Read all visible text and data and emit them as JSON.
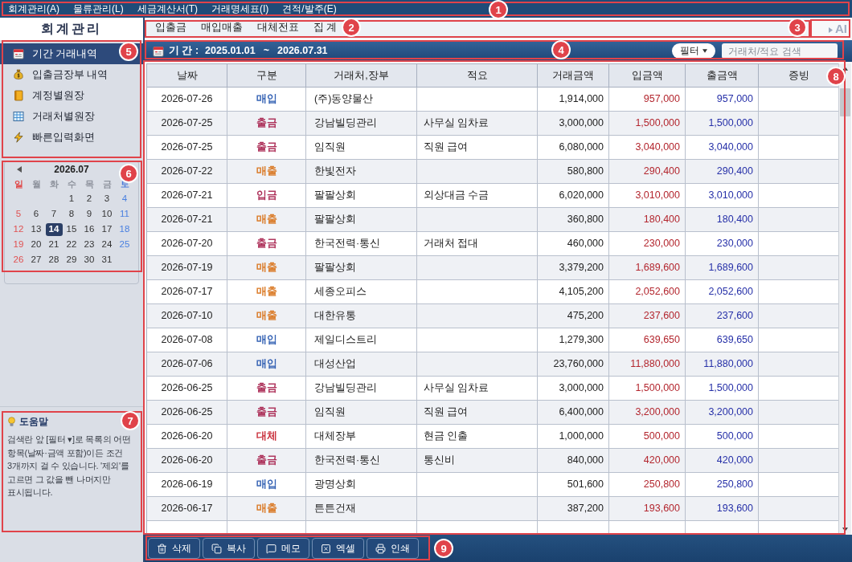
{
  "menu_bar": {
    "callout": "1",
    "items": [
      "회계관리(A)",
      "물류관리(L)",
      "세금계산서(T)",
      "거래명세표(I)",
      "견적/발주(E)"
    ]
  },
  "sidebar": {
    "title": "회계관리",
    "nav": {
      "callout": "5",
      "items": [
        {
          "label": "기간 거래내역",
          "selected": true
        },
        {
          "label": "입출금장부 내역",
          "selected": false
        },
        {
          "label": "계정별원장",
          "selected": false
        },
        {
          "label": "거래처별원장",
          "selected": false
        },
        {
          "label": "빠른입력화면",
          "selected": false
        }
      ]
    },
    "calendar": {
      "callout": "6",
      "month": "2026.07",
      "weekdays": [
        "일",
        "월",
        "화",
        "수",
        "목",
        "금",
        "토"
      ],
      "weeks": [
        {
          "days": [
            {
              "day": "1",
              "selected": false
            },
            {
              "day": "2",
              "selected": false
            },
            {
              "day": "3",
              "selected": false
            },
            {
              "day": "4",
              "selected": false
            }
          ]
        },
        {
          "days": [
            {
              "day": "5",
              "selected": false
            },
            {
              "day": "6",
              "selected": false
            },
            {
              "day": "7",
              "selected": false
            },
            {
              "day": "8",
              "selected": false
            },
            {
              "day": "9",
              "selected": false
            },
            {
              "day": "10",
              "selected": false
            },
            {
              "day": "11",
              "selected": false
            }
          ]
        },
        {
          "days": [
            {
              "day": "12",
              "selected": false
            },
            {
              "day": "13",
              "selected": false
            },
            {
              "day": "14",
              "selected": true
            },
            {
              "day": "15",
              "selected": false
            },
            {
              "day": "16",
              "selected": false
            },
            {
              "day": "17",
              "selected": false
            },
            {
              "day": "18",
              "selected": false
            }
          ]
        },
        {
          "days": [
            {
              "day": "19",
              "selected": false
            },
            {
              "day": "20",
              "selected": false
            },
            {
              "day": "21",
              "selected": false
            },
            {
              "day": "22",
              "selected": false
            },
            {
              "day": "23",
              "selected": false
            },
            {
              "day": "24",
              "selected": false
            },
            {
              "day": "25",
              "selected": false
            }
          ]
        },
        {
          "days": [
            {
              "day": "26",
              "selected": false
            },
            {
              "day": "27",
              "selected": false
            },
            {
              "day": "28",
              "selected": false
            },
            {
              "day": "29",
              "selected": false
            },
            {
              "day": "30",
              "selected": false
            },
            {
              "day": "31",
              "selected": false
            }
          ]
        }
      ]
    },
    "help": {
      "callout": "7",
      "title": "도움말",
      "text": "검색란 앞 [필터 ▾]로 목록의 어떤 항목(날짜·금액 포함)이든 조건 3개까지 걸 수 있습니다. '제외'를 고르면 그 값을 뺀 나머지만 표시됩니다."
    }
  },
  "tab_strip": {
    "callout": "2",
    "tabs": [
      {
        "label": "입출금",
        "selected": false
      },
      {
        "label": "매입매출",
        "selected": false
      },
      {
        "label": "대체전표",
        "selected": false
      },
      {
        "label": "집 계",
        "selected": false
      }
    ]
  },
  "ai_button": {
    "callout": "3",
    "label": "AI"
  },
  "period_bar": {
    "callout": "4",
    "label": "기 간 :",
    "start": "2025.01.01",
    "separator": "~",
    "end": "2026.07.31",
    "filter_button": {
      "label": "필터"
    },
    "search": {
      "placeholder": "거래처/적요 검색"
    }
  },
  "table": {
    "callout": "8",
    "columns": [
      "날짜",
      "구분",
      "거래처,장부",
      "적요",
      "거래금액",
      "입금액",
      "출금액",
      "증빙"
    ],
    "rows": [
      {
        "date": "2026-07-26",
        "type": "매입",
        "color": "#2a5ab0",
        "account": "(주)동양물산",
        "amount": "1,914,000",
        "deposit": "957,000",
        "withdrawal": "957,000"
      },
      {
        "date": "2026-07-25",
        "type": "출금",
        "color": "#a8234f",
        "account": "강남빌딩관리",
        "memo": "사무실 임차료",
        "amount": "3,000,000",
        "deposit": "1,500,000",
        "withdrawal": "1,500,000"
      },
      {
        "date": "2026-07-25",
        "type": "출금",
        "color": "#a8234f",
        "account": "임직원",
        "memo": "직원 급여",
        "amount": "6,080,000",
        "deposit": "3,040,000",
        "withdrawal": "3,040,000"
      },
      {
        "date": "2026-07-22",
        "type": "매출",
        "color": "#d9741c",
        "account": "한빛전자",
        "amount": "580,800",
        "deposit": "290,400",
        "withdrawal": "290,400"
      },
      {
        "date": "2026-07-21",
        "type": "입금",
        "color": "#a8234f",
        "account": "팔팔상회",
        "memo": "외상대금 수금",
        "amount": "6,020,000",
        "deposit": "3,010,000",
        "withdrawal": "3,010,000"
      },
      {
        "date": "2026-07-21",
        "type": "매출",
        "color": "#d9741c",
        "account": "팔팔상회",
        "amount": "360,800",
        "deposit": "180,400",
        "withdrawal": "180,400"
      },
      {
        "date": "2026-07-20",
        "type": "출금",
        "color": "#a8234f",
        "account": "한국전력·통신",
        "memo": "거래처 접대",
        "amount": "460,000",
        "deposit": "230,000",
        "withdrawal": "230,000"
      },
      {
        "date": "2026-07-19",
        "type": "매출",
        "color": "#d9741c",
        "account": "팔팔상회",
        "amount": "3,379,200",
        "deposit": "1,689,600",
        "withdrawal": "1,689,600"
      },
      {
        "date": "2026-07-17",
        "type": "매출",
        "color": "#d9741c",
        "account": "세종오피스",
        "amount": "4,105,200",
        "deposit": "2,052,600",
        "withdrawal": "2,052,600"
      },
      {
        "date": "2026-07-10",
        "type": "매출",
        "color": "#d9741c",
        "account": "대한유통",
        "amount": "475,200",
        "deposit": "237,600",
        "withdrawal": "237,600"
      },
      {
        "date": "2026-07-08",
        "type": "매입",
        "color": "#2a5ab0",
        "account": "제일디스트리",
        "amount": "1,279,300",
        "deposit": "639,650",
        "withdrawal": "639,650"
      },
      {
        "date": "2026-07-06",
        "type": "매입",
        "color": "#2a5ab0",
        "account": "대성산업",
        "amount": "23,760,000",
        "deposit": "11,880,000",
        "withdrawal": "11,880,000"
      },
      {
        "date": "2026-06-25",
        "type": "출금",
        "color": "#a8234f",
        "account": "강남빌딩관리",
        "memo": "사무실 임차료",
        "amount": "3,000,000",
        "deposit": "1,500,000",
        "withdrawal": "1,500,000"
      },
      {
        "date": "2026-06-25",
        "type": "출금",
        "color": "#a8234f",
        "account": "임직원",
        "memo": "직원 급여",
        "amount": "6,400,000",
        "deposit": "3,200,000",
        "withdrawal": "3,200,000"
      },
      {
        "date": "2026-06-20",
        "type": "대체",
        "color": "#c62430",
        "account": "대체장부",
        "memo": "현금 인출",
        "amount": "1,000,000",
        "deposit": "500,000",
        "withdrawal": "500,000"
      },
      {
        "date": "2026-06-20",
        "type": "출금",
        "color": "#a8234f",
        "account": "한국전력·통신",
        "memo": "통신비",
        "amount": "840,000",
        "deposit": "420,000",
        "withdrawal": "420,000"
      },
      {
        "date": "2026-06-19",
        "type": "매입",
        "color": "#2a5ab0",
        "account": "광명상회",
        "amount": "501,600",
        "deposit": "250,800",
        "withdrawal": "250,800"
      },
      {
        "date": "2026-06-17",
        "type": "매출",
        "color": "#d9741c",
        "account": "튼튼건재",
        "amount": "387,200",
        "deposit": "193,600",
        "withdrawal": "193,600"
      }
    ]
  },
  "toolbar": {
    "callout": "9",
    "buttons": [
      {
        "label": "삭제"
      },
      {
        "label": "복사"
      },
      {
        "label": "메모"
      },
      {
        "label": "엑셀"
      },
      {
        "label": "인쇄"
      }
    ]
  }
}
